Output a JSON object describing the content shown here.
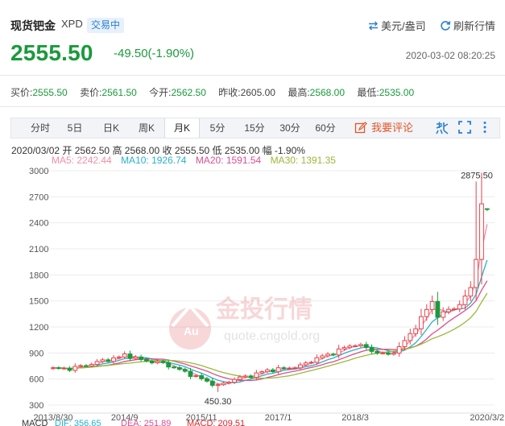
{
  "header": {
    "title": "现货钯金",
    "code": "XPD",
    "status_badge": "交易中",
    "currency_link": "美元/盎司",
    "refresh_link": "刷新行情",
    "price": "2555.50",
    "change": "-49.50(-1.90%)",
    "datetime": "2020-03-02 08:20:25",
    "colors": {
      "down": "#1a9a3c",
      "up": "#d7262b",
      "accent": "#2a7fd4"
    }
  },
  "quote": [
    {
      "label": "买价:",
      "value": "2555.50",
      "color": "green"
    },
    {
      "label": "卖价:",
      "value": "2561.50",
      "color": "green"
    },
    {
      "label": "今开:",
      "value": "2562.50",
      "color": "green"
    },
    {
      "label": "昨收:",
      "value": "2605.00",
      "color": "plain"
    },
    {
      "label": "最高:",
      "value": "2568.00",
      "color": "green"
    },
    {
      "label": "最低:",
      "value": "2535.00",
      "color": "green"
    }
  ],
  "tabs": [
    "分时",
    "5日",
    "日K",
    "周K",
    "月K",
    "5分",
    "15分",
    "30分",
    "60分"
  ],
  "active_tab": "月K",
  "comment_label": "我要评论",
  "toolbar_icons": [
    "brush-icon",
    "fullscreen-icon",
    "more-icon"
  ],
  "bar_info": "2020/03/02  开 2562.50  高 2568.00  收 2555.50  低 2535.00  幅 -1.90%",
  "ma_legend": [
    {
      "label": "MA5: 2242.44",
      "color": "#f28fa3"
    },
    {
      "label": "MA10: 1926.74",
      "color": "#2ab0c9"
    },
    {
      "label": "MA20: 1591.54",
      "color": "#d94f8f"
    },
    {
      "label": "MA30: 1391.35",
      "color": "#9cb83a"
    }
  ],
  "watermark": {
    "name": "金投行情",
    "url": "quote.cngold.org"
  },
  "chart_data": {
    "type": "candlestick",
    "y_ticks": [
      3000,
      2700,
      2400,
      2100,
      1800,
      1500,
      1200,
      900,
      600,
      300
    ],
    "ylim": [
      300,
      3000
    ],
    "x_labels": [
      {
        "label": "2013/8/30",
        "index": 0
      },
      {
        "label": "2014/9",
        "index": 13
      },
      {
        "label": "2015/11",
        "index": 27
      },
      {
        "label": "2017/1",
        "index": 41
      },
      {
        "label": "2018/3",
        "index": 55
      },
      {
        "label": "2020/3/2",
        "index": 79
      }
    ],
    "annotations": [
      {
        "label": "2875.50",
        "index": 78,
        "value": 2875.5
      },
      {
        "label": "450.30",
        "index": 30,
        "value": 450.3
      }
    ],
    "anchors": [
      [
        0,
        720
      ],
      [
        3,
        720
      ],
      [
        6,
        760
      ],
      [
        9,
        810
      ],
      [
        12,
        850
      ],
      [
        13,
        880
      ],
      [
        16,
        820
      ],
      [
        20,
        780
      ],
      [
        24,
        680
      ],
      [
        27,
        600
      ],
      [
        30,
        520
      ],
      [
        33,
        600
      ],
      [
        36,
        640
      ],
      [
        39,
        700
      ],
      [
        42,
        720
      ],
      [
        45,
        750
      ],
      [
        48,
        840
      ],
      [
        51,
        900
      ],
      [
        53,
        960
      ],
      [
        55,
        1000
      ],
      [
        57,
        960
      ],
      [
        59,
        900
      ],
      [
        61,
        880
      ],
      [
        63,
        960
      ],
      [
        66,
        1200
      ],
      [
        68,
        1400
      ],
      [
        69,
        1500
      ],
      [
        70,
        1320
      ],
      [
        72,
        1400
      ],
      [
        74,
        1450
      ],
      [
        76,
        1650
      ],
      [
        77,
        2000
      ],
      [
        78,
        2600
      ],
      [
        79,
        2555.5
      ]
    ],
    "last_candle": {
      "open": 2562.5,
      "high": 2568,
      "close": 2555.5,
      "low": 2535
    },
    "ma_colors": {
      "MA5": "#f28fa3",
      "MA10": "#2ab0c9",
      "MA20": "#d94f8f",
      "MA30": "#9cb83a"
    },
    "bull_color": "#e8434b",
    "bear_color": "#1a9a3c"
  },
  "macd": {
    "label": "MACD",
    "dif": "DIF: 356.65",
    "dea": "DEA: 251.89",
    "macd": "MACD: 209.51"
  }
}
